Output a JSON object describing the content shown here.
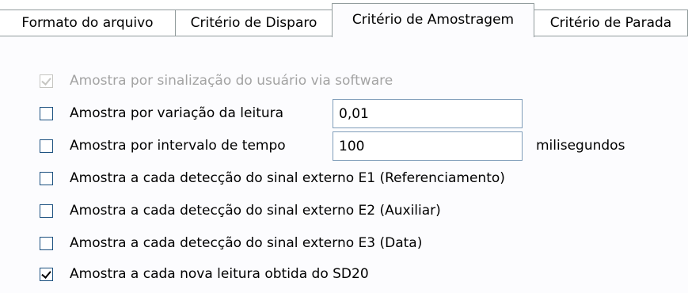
{
  "tabs": [
    {
      "label": "Formato do arquivo",
      "active": false
    },
    {
      "label": "Critério de Disparo",
      "active": false
    },
    {
      "label": "Critério de Amostragem",
      "active": true
    },
    {
      "label": "Critério de Parada",
      "active": false
    }
  ],
  "options": [
    {
      "label": "Amostra por sinalização do usuário via software",
      "checked": true,
      "enabled": false
    },
    {
      "label": "Amostra por variação da leitura",
      "checked": false,
      "enabled": true,
      "value": "0,01"
    },
    {
      "label": "Amostra por intervalo de tempo",
      "checked": false,
      "enabled": true,
      "value": "100",
      "unit": "milisegundos"
    },
    {
      "label": "Amostra a cada detecção do sinal externo E1 (Referenciamento)",
      "checked": false,
      "enabled": true
    },
    {
      "label": "Amostra a cada detecção do sinal externo E2 (Auxiliar)",
      "checked": false,
      "enabled": true
    },
    {
      "label": "Amostra a cada detecção do sinal externo E3 (Data)",
      "checked": false,
      "enabled": true
    },
    {
      "label": "Amostra a cada nova leitura obtida do SD20",
      "checked": true,
      "enabled": true
    }
  ],
  "colors": {
    "tab_border": "#919b9c",
    "checkbox_border": "#1c5180",
    "disabled_text": "#a3a3a3",
    "panel_background": "#fcfcfe"
  }
}
